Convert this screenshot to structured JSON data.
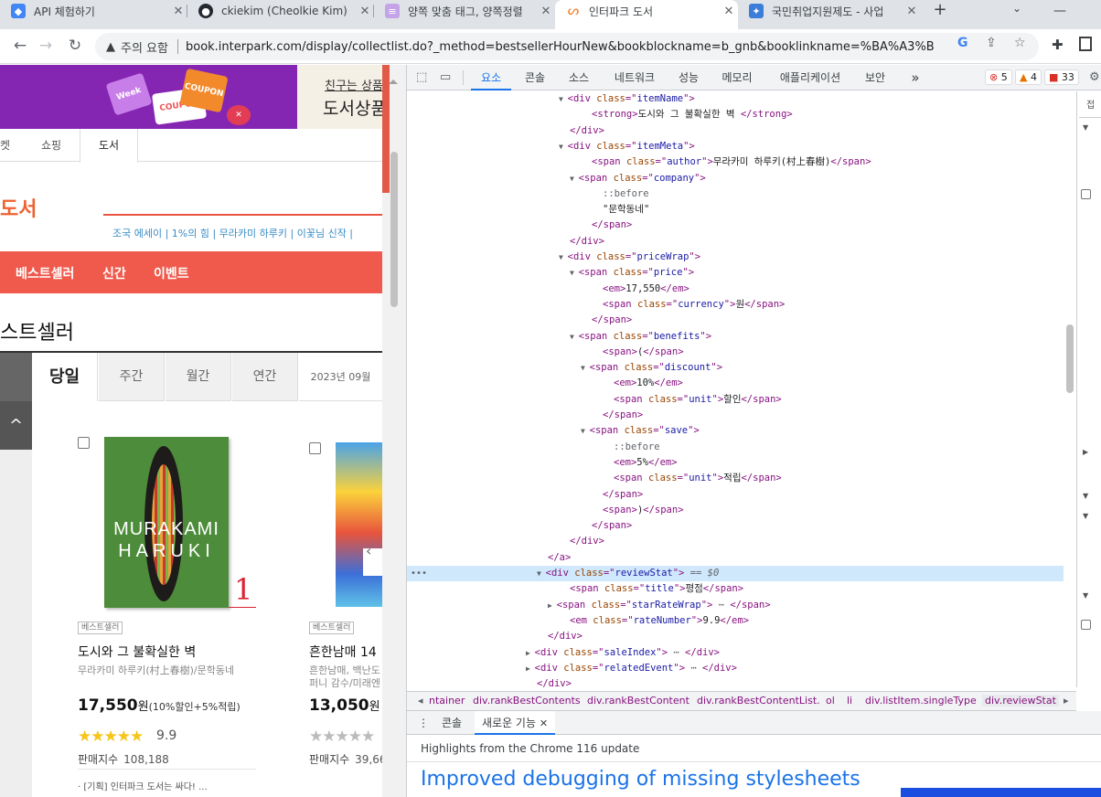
{
  "browser": {
    "tabs": [
      {
        "title": "API 체험하기",
        "icon": "google-cloud-icon",
        "color": "#4285f4"
      },
      {
        "title": "ckiekim (Cheolkie Kim)",
        "icon": "github-icon",
        "color": "#24292f"
      },
      {
        "title": "양쪽 맞춤 태그, 양쪽정렬",
        "icon": "stripe-icon",
        "color": "#c5a3e8"
      },
      {
        "title": "인터파크 도서",
        "icon": "interpark-icon",
        "color": "#f47920"
      },
      {
        "title": "국민취업지원제도 - 사업",
        "icon": "gov-icon",
        "color": "#3b7dd8"
      }
    ],
    "new_tab": "+",
    "security_label": "주의 요함",
    "url": "book.interpark.com/display/collectlist.do?_method=bestsellerHourNew&bookblockname=b_gnb&booklinkname=%BA%A3%BD..."
  },
  "page": {
    "banner": {
      "coupon1": "Week",
      "coupon2": "COUPON",
      "coupon3": "COUPON",
      "promo_line1": "친구는 상품",
      "promo_line2": "도서상품"
    },
    "nav_tabs": [
      "켓",
      "쇼핑",
      "도서"
    ],
    "logo_text": "도서",
    "keywords": "조국 에세이 |  1%의 힘 |  무라카미 하루키 |  이꽃님 신작 |",
    "menu": [
      "베스트셀러",
      "신간",
      "이벤트"
    ],
    "title": "스트셀러",
    "periods": [
      "당일",
      "주간",
      "월간",
      "연간"
    ],
    "date": "2023년 09월",
    "up_arrow": "^",
    "books": [
      {
        "rank": "1",
        "cover_text1": "MURAKAMI",
        "cover_text2": "HARUKI",
        "badge": "베스트셀러",
        "title": "도시와 그 불확실한 벽",
        "author": "무라카미 하루키(村上春樹)/문학동네",
        "price": "17,550",
        "currency": "원",
        "benefits": "(10%할인+5%적립)",
        "stars": "★★★★★",
        "rating": "9.9",
        "sales_label": "판매지수",
        "sales": "108,188",
        "note": "· [기획] 인터파크 도서는 싸다! ..."
      },
      {
        "badge": "베스트셀러",
        "title": "흔한남매 14",
        "author_line1": "흔한남매, 백난도",
        "author_line2": "퍼니 감수/미래엔",
        "price": "13,050",
        "currency": "원",
        "stars": "★★★★★",
        "sales_label": "판매지수",
        "sales": "39,66"
      }
    ]
  },
  "devtools": {
    "tabs": [
      "요소",
      "콘솔",
      "소스",
      "네트워크",
      "성능",
      "메모리",
      "애플리케이션",
      "보안"
    ],
    "more": "»",
    "errors": "5",
    "warnings": "4",
    "issues": "33",
    "side_label": "접",
    "crumbs": [
      "ntainer",
      "div.rankBestContents",
      "div.rankBestContent",
      "div.rankBestContentList.",
      "ol",
      "li",
      "div.listItem.singleType",
      "div.reviewStat"
    ],
    "drawer_tabs": [
      "콘솔",
      "새로운 기능"
    ],
    "whatsnew_header": "Highlights from the Chrome 116 update",
    "whatsnew_title": "Improved debugging of missing stylesheets"
  },
  "dom_lines": [
    {
      "indent": 15,
      "tri": "▼",
      "parts": [
        [
          "tg",
          "<div "
        ],
        [
          "an",
          "class"
        ],
        [
          "tg",
          "=\""
        ],
        [
          "av",
          "itemName"
        ],
        [
          "tg",
          "\">"
        ]
      ]
    },
    {
      "indent": 17,
      "tri": "",
      "parts": [
        [
          "tg",
          "<strong>"
        ],
        [
          "tx",
          "도시와 그 불확실한 벽 "
        ],
        [
          "tg",
          "</strong>"
        ]
      ]
    },
    {
      "indent": 15,
      "tri": "",
      "parts": [
        [
          "tg",
          "</div>"
        ]
      ]
    },
    {
      "indent": 15,
      "tri": "▼",
      "parts": [
        [
          "tg",
          "<div "
        ],
        [
          "an",
          "class"
        ],
        [
          "tg",
          "=\""
        ],
        [
          "av",
          "itemMeta"
        ],
        [
          "tg",
          "\">"
        ]
      ]
    },
    {
      "indent": 17,
      "tri": "",
      "parts": [
        [
          "tg",
          "<span "
        ],
        [
          "an",
          "class"
        ],
        [
          "tg",
          "=\""
        ],
        [
          "av",
          "author"
        ],
        [
          "tg",
          "\">"
        ],
        [
          "tx",
          "무라카미 하루키(村上春樹)"
        ],
        [
          "tg",
          "</span>"
        ]
      ]
    },
    {
      "indent": 16,
      "tri": "▼",
      "parts": [
        [
          "tg",
          "<span "
        ],
        [
          "an",
          "class"
        ],
        [
          "tg",
          "=\""
        ],
        [
          "av",
          "company"
        ],
        [
          "tg",
          "\">"
        ]
      ]
    },
    {
      "indent": 18,
      "tri": "",
      "parts": [
        [
          "ps",
          "::before"
        ]
      ]
    },
    {
      "indent": 18,
      "tri": "",
      "parts": [
        [
          "tx",
          "\"문학동네\""
        ]
      ]
    },
    {
      "indent": 17,
      "tri": "",
      "parts": [
        [
          "tg",
          "</span>"
        ]
      ]
    },
    {
      "indent": 15,
      "tri": "",
      "parts": [
        [
          "tg",
          "</div>"
        ]
      ]
    },
    {
      "indent": 15,
      "tri": "▼",
      "parts": [
        [
          "tg",
          "<div "
        ],
        [
          "an",
          "class"
        ],
        [
          "tg",
          "=\""
        ],
        [
          "av",
          "priceWrap"
        ],
        [
          "tg",
          "\">"
        ]
      ]
    },
    {
      "indent": 16,
      "tri": "▼",
      "parts": [
        [
          "tg",
          "<span "
        ],
        [
          "an",
          "class"
        ],
        [
          "tg",
          "=\""
        ],
        [
          "av",
          "price"
        ],
        [
          "tg",
          "\">"
        ]
      ]
    },
    {
      "indent": 18,
      "tri": "",
      "parts": [
        [
          "tg",
          "<em>"
        ],
        [
          "tx",
          "17,550"
        ],
        [
          "tg",
          "</em>"
        ]
      ]
    },
    {
      "indent": 18,
      "tri": "",
      "parts": [
        [
          "tg",
          "<span "
        ],
        [
          "an",
          "class"
        ],
        [
          "tg",
          "=\""
        ],
        [
          "av",
          "currency"
        ],
        [
          "tg",
          "\">"
        ],
        [
          "tx",
          "원"
        ],
        [
          "tg",
          "</span>"
        ]
      ]
    },
    {
      "indent": 17,
      "tri": "",
      "parts": [
        [
          "tg",
          "</span>"
        ]
      ]
    },
    {
      "indent": 16,
      "tri": "▼",
      "parts": [
        [
          "tg",
          "<span "
        ],
        [
          "an",
          "class"
        ],
        [
          "tg",
          "=\""
        ],
        [
          "av",
          "benefits"
        ],
        [
          "tg",
          "\">"
        ]
      ]
    },
    {
      "indent": 18,
      "tri": "",
      "parts": [
        [
          "tg",
          "<span>"
        ],
        [
          "tx",
          "("
        ],
        [
          "tg",
          "</span>"
        ]
      ]
    },
    {
      "indent": 17,
      "tri": "▼",
      "parts": [
        [
          "tg",
          "<span "
        ],
        [
          "an",
          "class"
        ],
        [
          "tg",
          "=\""
        ],
        [
          "av",
          "discount"
        ],
        [
          "tg",
          "\">"
        ]
      ]
    },
    {
      "indent": 19,
      "tri": "",
      "parts": [
        [
          "tg",
          "<em>"
        ],
        [
          "tx",
          "10%"
        ],
        [
          "tg",
          "</em>"
        ]
      ]
    },
    {
      "indent": 19,
      "tri": "",
      "parts": [
        [
          "tg",
          "<span "
        ],
        [
          "an",
          "class"
        ],
        [
          "tg",
          "=\""
        ],
        [
          "av",
          "unit"
        ],
        [
          "tg",
          "\">"
        ],
        [
          "tx",
          "할인"
        ],
        [
          "tg",
          "</span>"
        ]
      ]
    },
    {
      "indent": 18,
      "tri": "",
      "parts": [
        [
          "tg",
          "</span>"
        ]
      ]
    },
    {
      "indent": 17,
      "tri": "▼",
      "parts": [
        [
          "tg",
          "<span "
        ],
        [
          "an",
          "class"
        ],
        [
          "tg",
          "=\""
        ],
        [
          "av",
          "save"
        ],
        [
          "tg",
          "\">"
        ]
      ]
    },
    {
      "indent": 19,
      "tri": "",
      "parts": [
        [
          "ps",
          "::before"
        ]
      ]
    },
    {
      "indent": 19,
      "tri": "",
      "parts": [
        [
          "tg",
          "<em>"
        ],
        [
          "tx",
          "5%"
        ],
        [
          "tg",
          "</em>"
        ]
      ]
    },
    {
      "indent": 19,
      "tri": "",
      "parts": [
        [
          "tg",
          "<span "
        ],
        [
          "an",
          "class"
        ],
        [
          "tg",
          "=\""
        ],
        [
          "av",
          "unit"
        ],
        [
          "tg",
          "\">"
        ],
        [
          "tx",
          "적립"
        ],
        [
          "tg",
          "</span>"
        ]
      ]
    },
    {
      "indent": 18,
      "tri": "",
      "parts": [
        [
          "tg",
          "</span>"
        ]
      ]
    },
    {
      "indent": 18,
      "tri": "",
      "parts": [
        [
          "tg",
          "<span>"
        ],
        [
          "tx",
          ")"
        ],
        [
          "tg",
          "</span>"
        ]
      ]
    },
    {
      "indent": 17,
      "tri": "",
      "parts": [
        [
          "tg",
          "</span>"
        ]
      ]
    },
    {
      "indent": 15,
      "tri": "",
      "parts": [
        [
          "tg",
          "</div>"
        ]
      ]
    },
    {
      "indent": 13,
      "tri": "",
      "parts": [
        [
          "tg",
          "</a>"
        ]
      ]
    },
    {
      "indent": 13,
      "tri": "▼",
      "sel": true,
      "parts": [
        [
          "tg",
          "<div "
        ],
        [
          "an",
          "class"
        ],
        [
          "tg",
          "=\""
        ],
        [
          "av",
          "reviewStat"
        ],
        [
          "tg",
          "\">"
        ],
        [
          "eq",
          " == $0"
        ]
      ]
    },
    {
      "indent": 15,
      "tri": "",
      "parts": [
        [
          "tg",
          "<span "
        ],
        [
          "an",
          "class"
        ],
        [
          "tg",
          "=\""
        ],
        [
          "av",
          "title"
        ],
        [
          "tg",
          "\">"
        ],
        [
          "tx",
          "평점"
        ],
        [
          "tg",
          "</span>"
        ]
      ]
    },
    {
      "indent": 14,
      "tri": "▶",
      "parts": [
        [
          "tg",
          "<span "
        ],
        [
          "an",
          "class"
        ],
        [
          "tg",
          "=\""
        ],
        [
          "av",
          "starRateWrap"
        ],
        [
          "tg",
          "\">"
        ],
        [
          "ps",
          " ⋯ "
        ],
        [
          "tg",
          "</span>"
        ]
      ]
    },
    {
      "indent": 15,
      "tri": "",
      "parts": [
        [
          "tg",
          "<em "
        ],
        [
          "an",
          "class"
        ],
        [
          "tg",
          "=\""
        ],
        [
          "av",
          "rateNumber"
        ],
        [
          "tg",
          "\">"
        ],
        [
          "tx",
          "9.9"
        ],
        [
          "tg",
          "</em>"
        ]
      ]
    },
    {
      "indent": 13,
      "tri": "",
      "parts": [
        [
          "tg",
          "</div>"
        ]
      ]
    },
    {
      "indent": 12,
      "tri": "▶",
      "parts": [
        [
          "tg",
          "<div "
        ],
        [
          "an",
          "class"
        ],
        [
          "tg",
          "=\""
        ],
        [
          "av",
          "saleIndex"
        ],
        [
          "tg",
          "\">"
        ],
        [
          "ps",
          " ⋯ "
        ],
        [
          "tg",
          "</div>"
        ]
      ]
    },
    {
      "indent": 12,
      "tri": "▶",
      "parts": [
        [
          "tg",
          "<div "
        ],
        [
          "an",
          "class"
        ],
        [
          "tg",
          "=\""
        ],
        [
          "av",
          "relatedEvent"
        ],
        [
          "tg",
          "\">"
        ],
        [
          "ps",
          " ⋯ "
        ],
        [
          "tg",
          "</div>"
        ]
      ]
    },
    {
      "indent": 12,
      "tri": "",
      "parts": [
        [
          "tg",
          "</div>"
        ]
      ]
    }
  ]
}
